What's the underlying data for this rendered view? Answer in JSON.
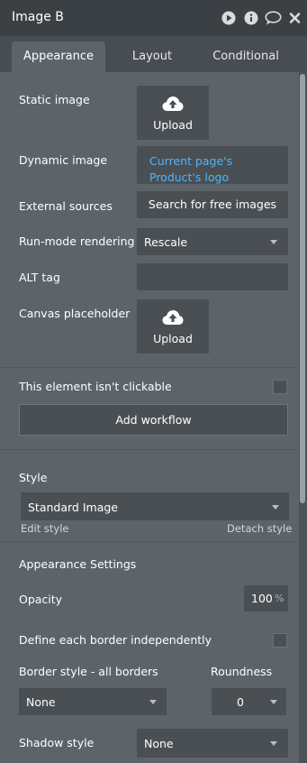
{
  "header": {
    "title": "Image B",
    "icons": [
      "play-icon",
      "info-icon",
      "comment-icon",
      "close-icon"
    ]
  },
  "tabs": [
    {
      "label": "Appearance",
      "active": true
    },
    {
      "label": "Layout",
      "active": false
    },
    {
      "label": "Conditional",
      "active": false
    }
  ],
  "properties": {
    "static_image": {
      "label": "Static image",
      "button": "Upload"
    },
    "dynamic_image": {
      "label": "Dynamic image",
      "value": "Current page's Product's logo"
    },
    "external_sources": {
      "label": "External sources",
      "button": "Search for free images"
    },
    "run_mode_rendering": {
      "label": "Run-mode rendering",
      "value": "Rescale"
    },
    "alt_tag": {
      "label": "ALT tag",
      "value": ""
    },
    "canvas_placeholder": {
      "label": "Canvas placeholder",
      "button": "Upload"
    },
    "not_clickable": {
      "label": "This element isn't clickable",
      "checked": false
    },
    "add_workflow": {
      "label": "Add workflow"
    }
  },
  "style_section": {
    "label": "Style",
    "value": "Standard Image",
    "edit_link": "Edit style",
    "detach_link": "Detach style"
  },
  "appearance_settings": {
    "title": "Appearance Settings",
    "opacity_label": "Opacity",
    "opacity_value": "100",
    "opacity_unit": "%",
    "border_independent_label": "Define each border independently",
    "border_independent_checked": false,
    "border_style_label": "Border style - all borders",
    "border_style_value": "None",
    "roundness_label": "Roundness",
    "roundness_value": "0",
    "shadow_style_label": "Shadow style",
    "shadow_style_value": "None"
  },
  "colors": {
    "panel": "#5d6469",
    "header": "#3b4045",
    "field": "#4a4f54",
    "link": "#4fb7f5"
  }
}
